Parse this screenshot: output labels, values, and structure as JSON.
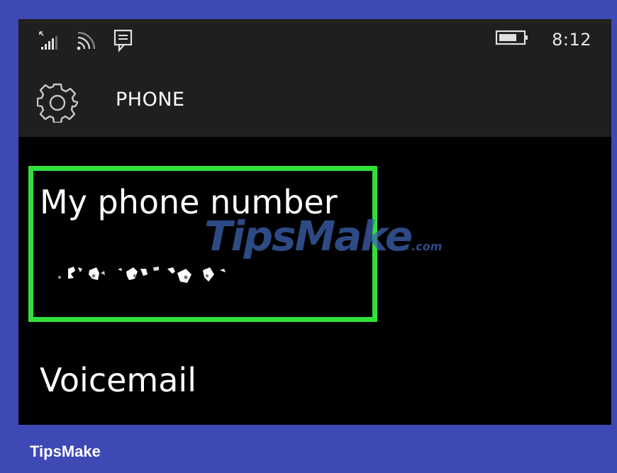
{
  "status_bar": {
    "time": "8:12",
    "icons": [
      "signal-icon",
      "wifi-icon",
      "message-icon",
      "battery-icon"
    ]
  },
  "header": {
    "title": "PHONE",
    "icon": "gear-icon"
  },
  "settings": {
    "my_phone_number_label": "My phone number",
    "voicemail_label": "Voicemail"
  },
  "watermark": {
    "text": "TipsMake",
    "suffix": ".com"
  },
  "brand": "TipsMake",
  "colors": {
    "frame_background": "#3e49b6",
    "screen_background": "#000000",
    "bar_background": "#1f1f1f",
    "highlight": "#2fe03a"
  }
}
